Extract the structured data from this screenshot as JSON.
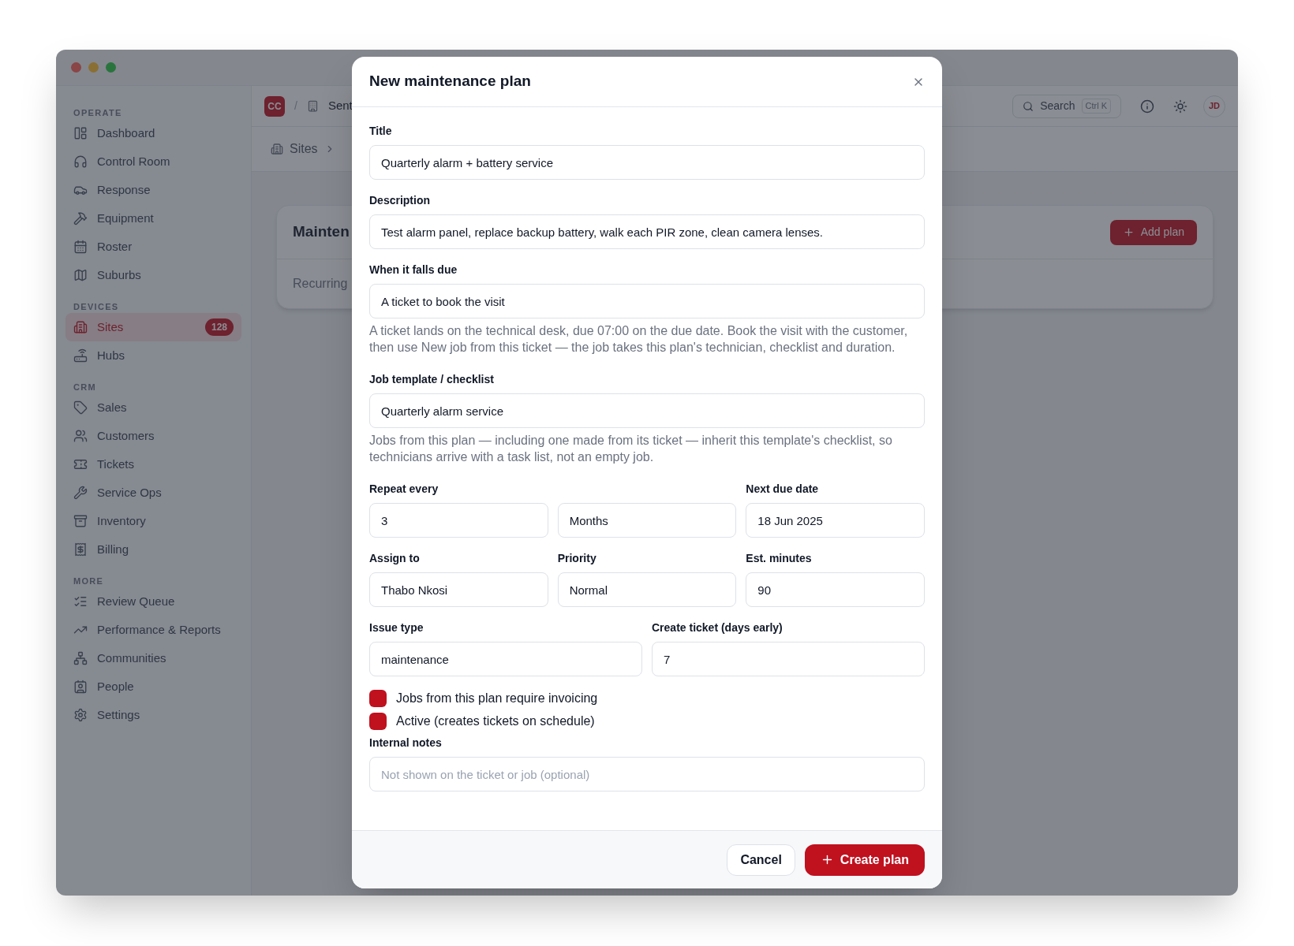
{
  "topbar": {
    "org_badge": "CC",
    "separator": "/",
    "org_name": "Sent",
    "search": {
      "label": "Search",
      "shortcut": "Ctrl K"
    },
    "avatar": "JD"
  },
  "sidebar": {
    "sections": [
      {
        "heading": "OPERATE",
        "items": [
          {
            "label": "Dashboard",
            "selected": false
          },
          {
            "label": "Control Room",
            "selected": false
          },
          {
            "label": "Response",
            "selected": false
          },
          {
            "label": "Equipment",
            "selected": false
          },
          {
            "label": "Roster",
            "selected": false
          },
          {
            "label": "Suburbs",
            "selected": false
          }
        ]
      },
      {
        "heading": "DEVICES",
        "items": [
          {
            "label": "Sites",
            "selected": true,
            "badge": "128"
          },
          {
            "label": "Hubs",
            "selected": false
          }
        ]
      },
      {
        "heading": "CRM",
        "items": [
          {
            "label": "Sales",
            "selected": false
          },
          {
            "label": "Customers",
            "selected": false
          },
          {
            "label": "Tickets",
            "selected": false
          },
          {
            "label": "Service Ops",
            "selected": false
          },
          {
            "label": "Inventory",
            "selected": false
          },
          {
            "label": "Billing",
            "selected": false
          }
        ]
      },
      {
        "heading": "MORE",
        "items": [
          {
            "label": "Review Queue",
            "selected": false
          },
          {
            "label": "Performance & Reports",
            "selected": false
          },
          {
            "label": "Communities",
            "selected": false
          },
          {
            "label": "People",
            "selected": false
          },
          {
            "label": "Settings",
            "selected": false
          }
        ]
      }
    ]
  },
  "breadcrumb": [
    "Sites"
  ],
  "card": {
    "title": "Mainten",
    "subtitle": "Recurring",
    "button": "Add plan"
  },
  "dialog": {
    "title": "New maintenance plan",
    "form": [
      {
        "kind": "field",
        "label": "Title",
        "value": "Quarterly alarm + battery service"
      },
      {
        "kind": "field",
        "label": "Description",
        "value": "Test alarm panel, replace backup battery, walk each PIR zone, clean camera lenses."
      },
      {
        "kind": "field",
        "label": "When it falls due",
        "value": "A ticket to book the visit",
        "help": "A ticket lands on the technical desk, due 07:00 on the due date. Book the visit with the customer, then use New job from this ticket — the job takes this plan's technician, checklist and duration."
      },
      {
        "kind": "field",
        "label": "Job template / checklist",
        "value": "Quarterly alarm service",
        "help": "Jobs from this plan — including one made from its ticket — inherit this template's checklist, so technicians arrive with a task list, not an empty job."
      },
      {
        "kind": "row",
        "fields": [
          {
            "label": "Repeat every",
            "value": "3"
          },
          {
            "value": "Months"
          },
          {
            "label": "Next due date",
            "value": "18 Jun 2025"
          }
        ]
      },
      {
        "kind": "row",
        "fields": [
          {
            "label": "Assign to",
            "value": "Thabo Nkosi"
          },
          {
            "label": "Priority",
            "value": "Normal"
          },
          {
            "label": "Est. minutes",
            "value": "90"
          }
        ]
      },
      {
        "kind": "row",
        "fields": [
          {
            "label": "Issue type",
            "value": "maintenance"
          },
          {
            "label": "Create ticket (days early)",
            "value": "7"
          }
        ]
      },
      {
        "kind": "checkbox",
        "label": "Jobs from this plan require invoicing",
        "checked": true
      },
      {
        "kind": "checkbox",
        "label": "Active (creates tickets on schedule)",
        "checked": true
      },
      {
        "kind": "field",
        "label": "Internal notes",
        "placeholder": "Not shown on the ticket or job (optional)"
      }
    ],
    "buttons": [
      {
        "label": "Cancel",
        "kind": "secondary"
      },
      {
        "label": "Create plan",
        "kind": "primary"
      }
    ]
  }
}
